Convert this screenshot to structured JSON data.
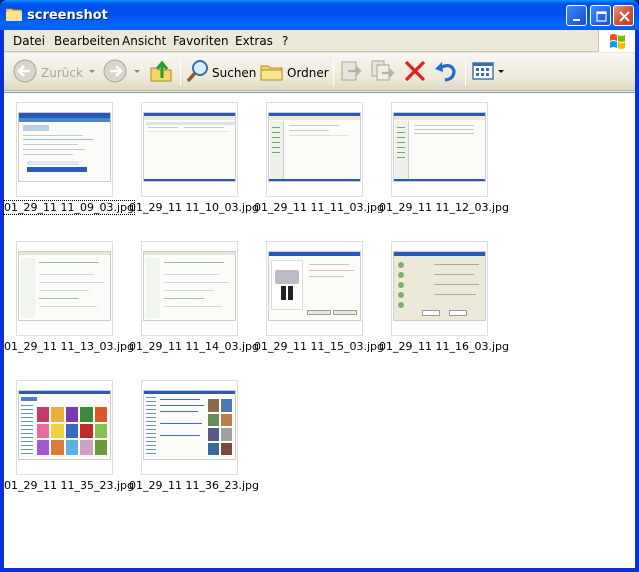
{
  "window": {
    "title": "screenshot",
    "minimize_label": "",
    "maximize_label": "",
    "close_label": ""
  },
  "menu": {
    "items": [
      {
        "label": "Datei"
      },
      {
        "label": "Bearbeiten"
      },
      {
        "label": "Ansicht"
      },
      {
        "label": "Favoriten"
      },
      {
        "label": "Extras"
      },
      {
        "label": "?"
      }
    ]
  },
  "toolbar": {
    "back_label": "Zurück",
    "search_label": "Suchen",
    "folders_label": "Ordner"
  },
  "files": [
    {
      "name": "01_29_11 11_09_03.jpg"
    },
    {
      "name": "01_29_11 11_10_03.jpg"
    },
    {
      "name": "01_29_11 11_11_03.jpg"
    },
    {
      "name": "01_29_11 11_12_03.jpg"
    },
    {
      "name": "01_29_11 11_13_03.jpg"
    },
    {
      "name": "01_29_11 11_14_03.jpg"
    },
    {
      "name": "01_29_11 11_15_03.jpg"
    },
    {
      "name": "01_29_11 11_16_03.jpg"
    },
    {
      "name": "01_29_11 11_35_23.jpg"
    },
    {
      "name": "01_29_11 11_36_23.jpg"
    }
  ],
  "colors": {
    "titlebar": "#0054e3",
    "frame": "#ece9d8",
    "content": "#ffffff",
    "delete_icon": "#e0201a",
    "undo_icon": "#1d6fd6"
  },
  "icons": {
    "title": "folder-icon",
    "back": "back-arrow-icon",
    "forward": "forward-arrow-icon",
    "up": "folder-up-icon",
    "search": "magnifier-icon",
    "folders": "folders-icon",
    "move": "move-to-icon",
    "copy": "copy-to-icon",
    "delete": "delete-icon",
    "undo": "undo-icon",
    "views": "views-icon"
  }
}
